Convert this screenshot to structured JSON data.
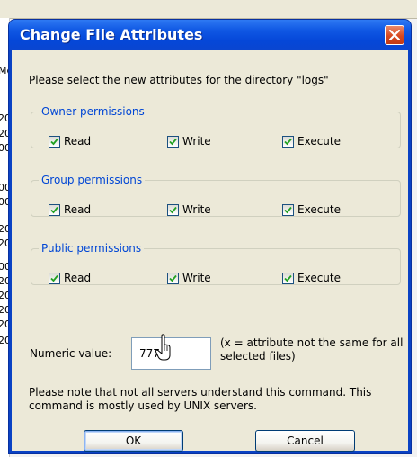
{
  "background": {
    "list_cells": [
      "Mc",
      "20",
      "20",
      "00",
      "00",
      "00",
      "20",
      "20",
      "00",
      "20",
      "20",
      "20",
      "20",
      "20"
    ]
  },
  "dialog": {
    "title": "Change File Attributes",
    "intro": "Please select the new attributes for the directory \"logs\"",
    "groups": [
      {
        "legend": "Owner permissions",
        "read": "Read",
        "write": "Write",
        "execute": "Execute",
        "read_checked": true,
        "write_checked": true,
        "execute_checked": true
      },
      {
        "legend": "Group permissions",
        "read": "Read",
        "write": "Write",
        "execute": "Execute",
        "read_checked": true,
        "write_checked": true,
        "execute_checked": true
      },
      {
        "legend": "Public permissions",
        "read": "Read",
        "write": "Write",
        "execute": "Execute",
        "read_checked": true,
        "write_checked": true,
        "execute_checked": true
      }
    ],
    "numeric_label": "Numeric value:",
    "numeric_value": "777",
    "numeric_note": "(x = attribute not the same for all selected files)",
    "note": "Please note that not all servers understand this command. This command is mostly used by UNIX servers.",
    "ok_label": "OK",
    "cancel_label": "Cancel"
  },
  "colors": {
    "title_bar": "#0547d8",
    "legend_text": "#0046d5",
    "close_button": "#d8481f",
    "dialog_face": "#ece9d8",
    "checkmark": "#21a121"
  },
  "icons": [
    "close-icon",
    "checkmark-icon",
    "mouse-cursor-icon"
  ]
}
